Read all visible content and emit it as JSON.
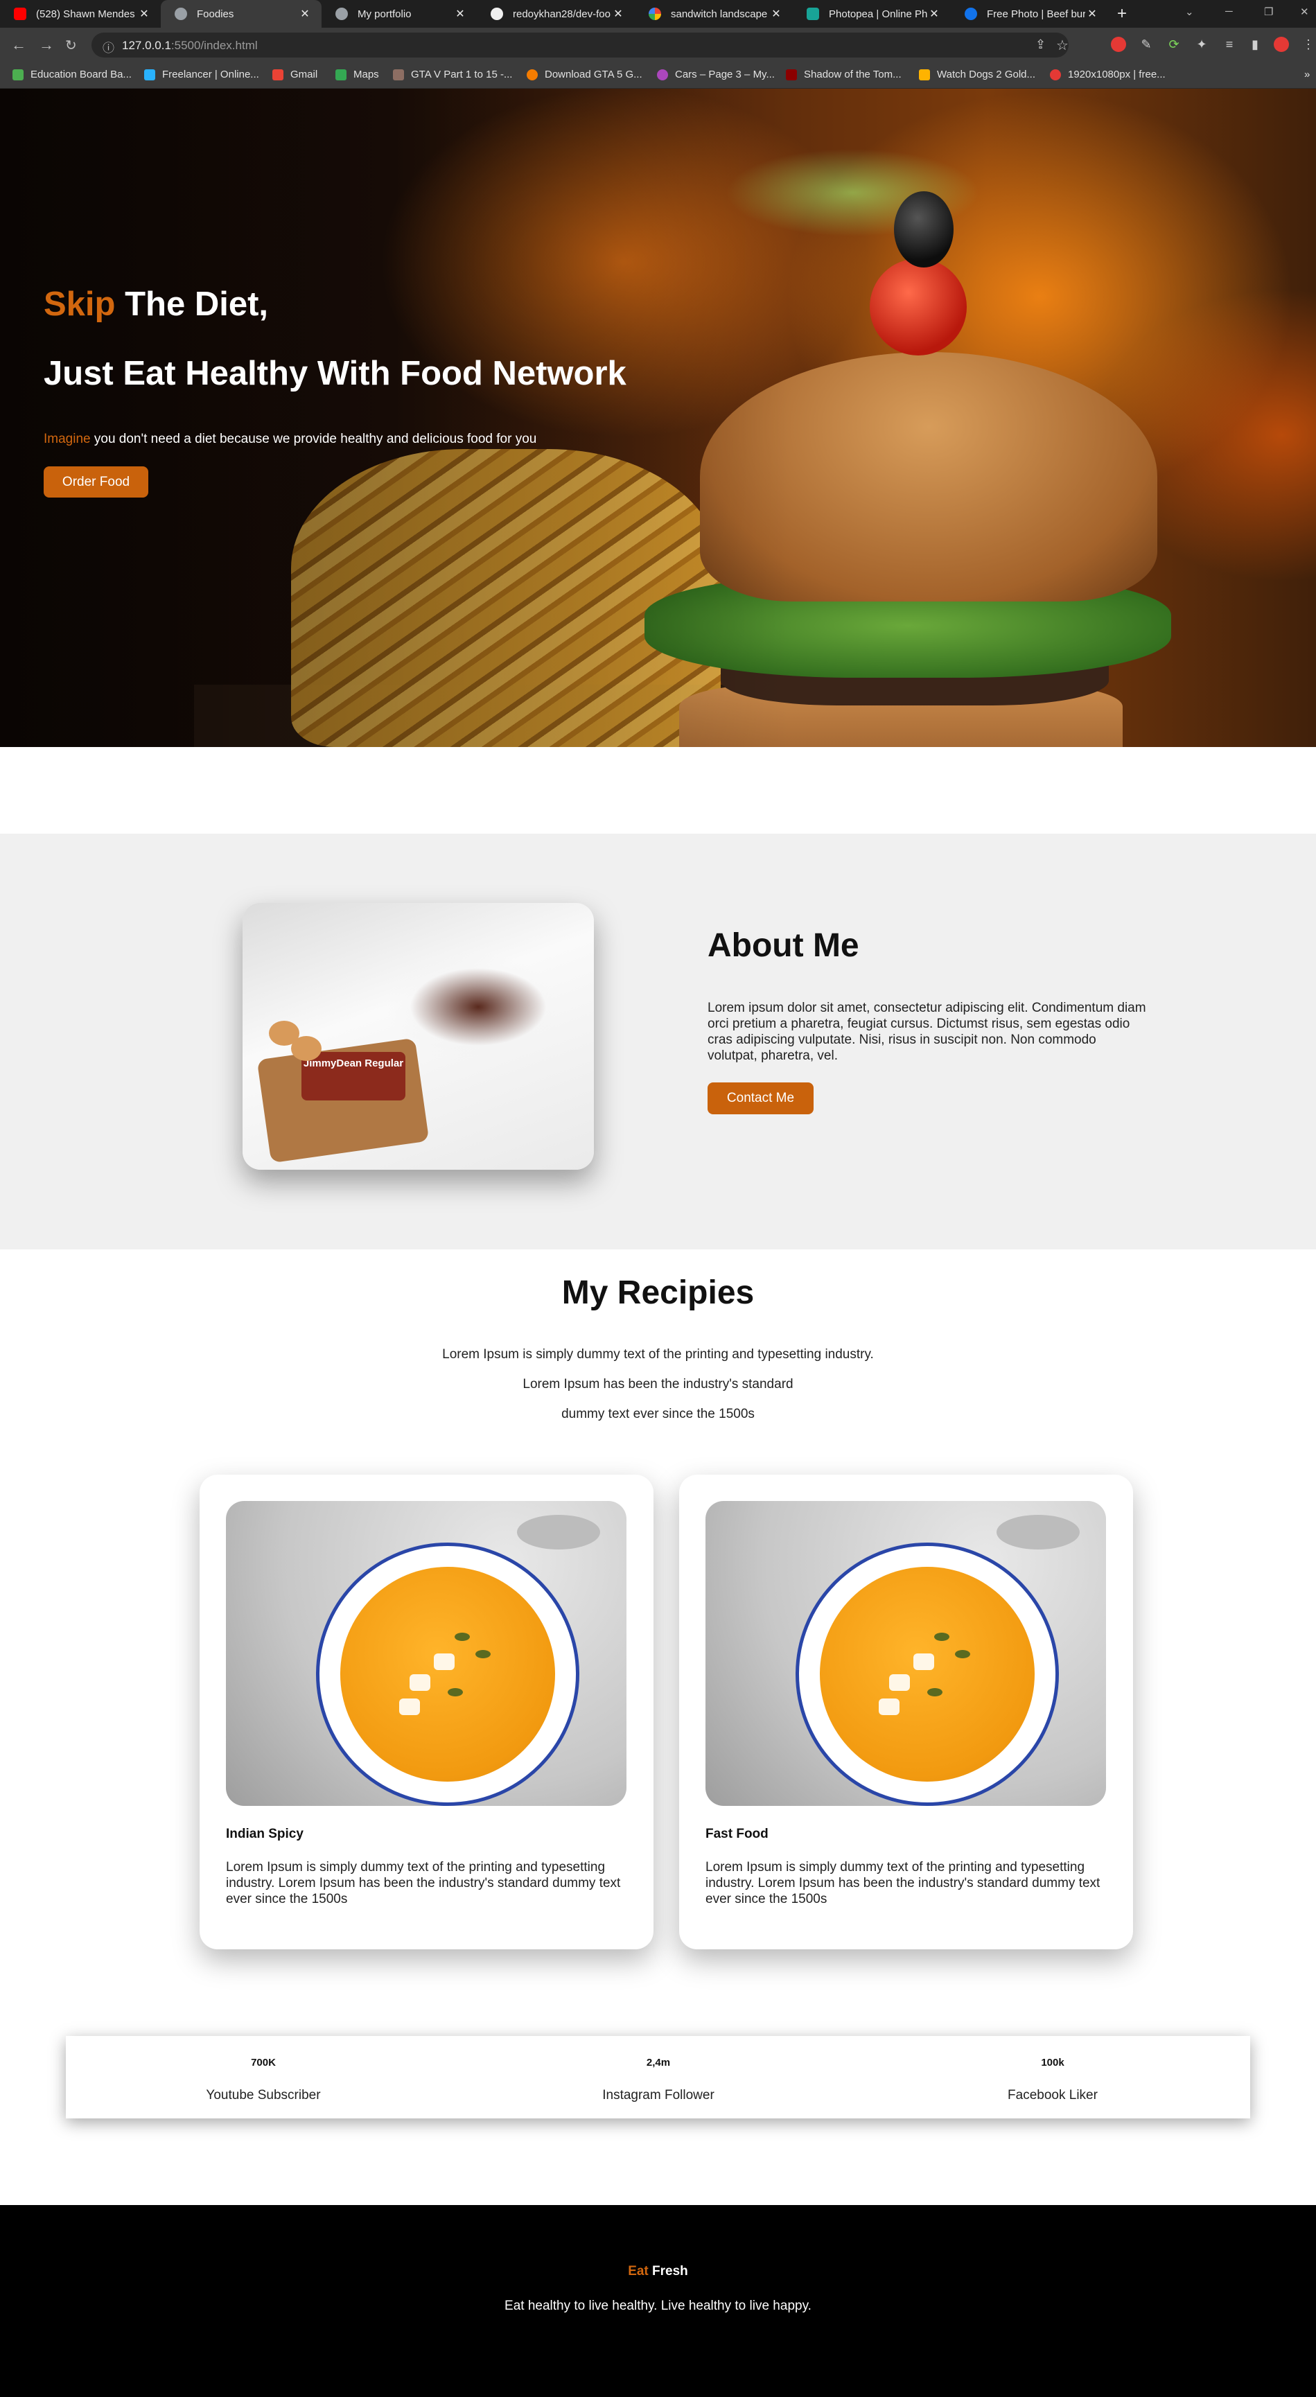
{
  "browser": {
    "tabs": [
      {
        "title": "(528) Shawn Mendes",
        "favicon": "youtube-icon",
        "active": false
      },
      {
        "title": "Foodies",
        "favicon": "globe-icon",
        "active": true
      },
      {
        "title": "My portfolio",
        "favicon": "globe-icon",
        "active": false
      },
      {
        "title": "redoykhan28/dev-foo",
        "favicon": "github-icon",
        "active": false
      },
      {
        "title": "sandwitch landscape",
        "favicon": "google-icon",
        "active": false
      },
      {
        "title": "Photopea | Online Ph",
        "favicon": "photopea-icon",
        "active": false
      },
      {
        "title": "Free Photo | Beef bur",
        "favicon": "freepik-icon",
        "active": false
      }
    ],
    "new_tab": "+",
    "url_host": "127.0.0.1",
    "url_rest": ":5500/index.html",
    "bookmarks": [
      "Education Board Ba...",
      "Freelancer | Online...",
      "Gmail",
      "Maps",
      "GTA V Part 1 to 15 -...",
      "Download GTA 5 G...",
      "Cars – Page 3 – My...",
      "Shadow of the Tom...",
      "Watch Dogs 2 Gold...",
      "1920x1080px | free..."
    ],
    "bookmarks_overflow": "»"
  },
  "hero": {
    "title1_accent": "Skip",
    "title1_rest": " The Diet,",
    "title2": "Just Eat Healthy With Food Network",
    "subtitle_accent": "Imagine",
    "subtitle_rest": " you don't need a diet because we provide healthy and delicious food for you",
    "order_button": "Order Food"
  },
  "about": {
    "title": "About Me",
    "text": "Lorem ipsum dolor sit amet, consectetur adipiscing elit. Condimentum diam orci pretium a pharetra, feugiat cursus. Dictumst risus, sem egestas odio cras adipiscing vulputate. Nisi, risus in suscipit non. Non commodo volutpat, pharetra, vel.",
    "contact_button": "Contact Me",
    "photo_label": "JimmyDean Regular"
  },
  "recipes": {
    "title": "My Recipies",
    "intro": [
      "Lorem Ipsum is simply dummy text of the printing and typesetting industry.",
      "Lorem Ipsum has been the industry's standard",
      "dummy text ever since the 1500s"
    ],
    "cards": [
      {
        "title": "Indian Spicy",
        "text": "Lorem Ipsum is simply dummy text of the printing and typesetting industry. Lorem Ipsum has been the industry's standard dummy text ever since the 1500s"
      },
      {
        "title": "Fast Food",
        "text": "Lorem Ipsum is simply dummy text of the printing and typesetting industry. Lorem Ipsum has been the industry's standard dummy text ever since the 1500s"
      }
    ]
  },
  "stats": [
    {
      "value": "700K",
      "label": "Youtube Subscriber"
    },
    {
      "value": "2,4m",
      "label": "Instagram Follower"
    },
    {
      "value": "100k",
      "label": "Facebook Liker"
    }
  ],
  "footer": {
    "title_accent": "Eat",
    "title_rest": " Fresh",
    "text": "Eat healthy to live healthy. Live healthy to live happy."
  },
  "colors": {
    "accent": "#c9620c",
    "footer_bg": "#000000",
    "section_bg": "#f0f0f0"
  }
}
